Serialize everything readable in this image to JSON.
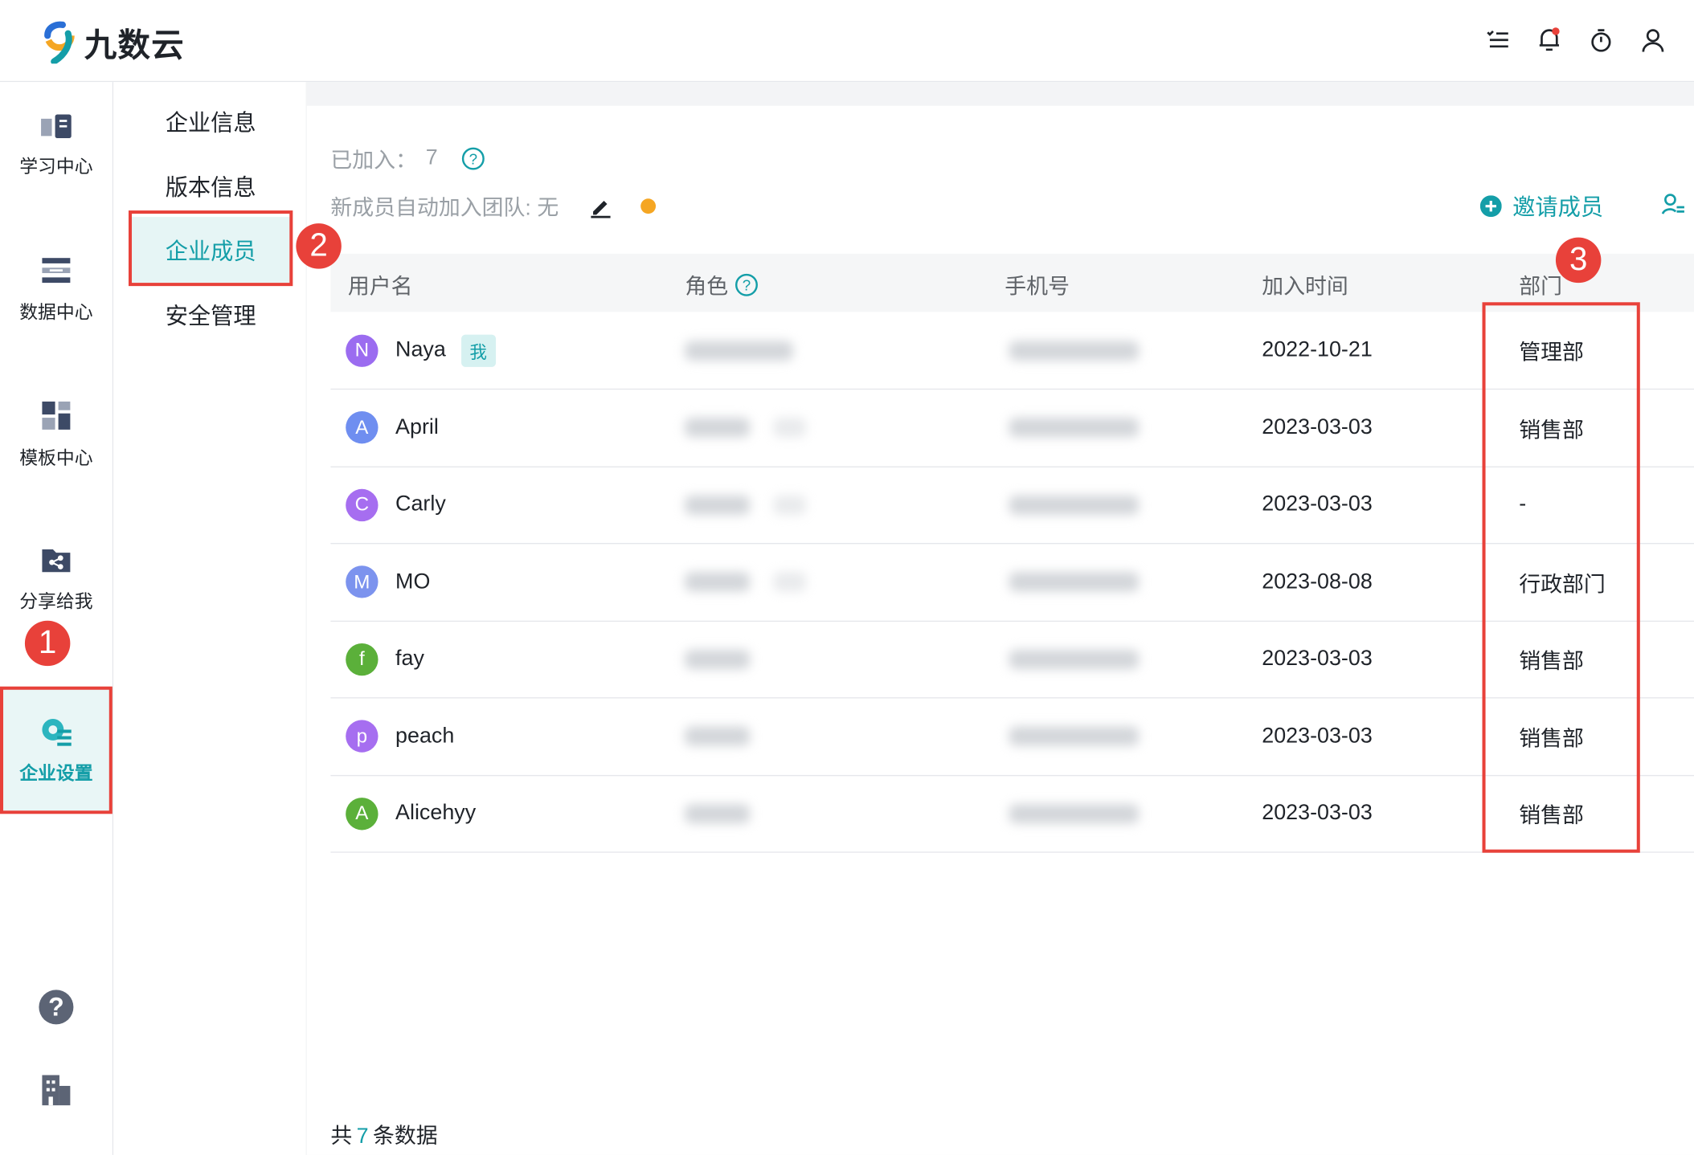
{
  "app": {
    "name": "九数云"
  },
  "leftnav": [
    {
      "label": "学习中心",
      "icon": "book-icon"
    },
    {
      "label": "数据中心",
      "icon": "database-icon"
    },
    {
      "label": "模板中心",
      "icon": "template-icon"
    },
    {
      "label": "分享给我",
      "icon": "share-folder-icon"
    },
    {
      "label": "企业设置",
      "icon": "enterprise-settings-icon"
    }
  ],
  "subnav": [
    "企业信息",
    "版本信息",
    "企业成员",
    "安全管理"
  ],
  "main": {
    "joined_label": "已加入：",
    "joined_count": "7",
    "autojoin_label": "新成员自动加入团队: 无",
    "invite_label": "邀请成员"
  },
  "table": {
    "headers": [
      "用户名",
      "角色",
      "手机号",
      "加入时间",
      "部门"
    ],
    "me_tag": "我",
    "rows": [
      {
        "initial": "N",
        "name": "Naya",
        "date": "2022-10-21",
        "dept": "管理部",
        "color": "#9b6cf0"
      },
      {
        "initial": "A",
        "name": "April",
        "date": "2023-03-03",
        "dept": "销售部",
        "color": "#6f8ef0"
      },
      {
        "initial": "C",
        "name": "Carly",
        "date": "2023-03-03",
        "dept": "-",
        "color": "#a66ef0"
      },
      {
        "initial": "M",
        "name": "MO",
        "date": "2023-08-08",
        "dept": "行政部门",
        "color": "#7c93ee"
      },
      {
        "initial": "f",
        "name": "fay",
        "date": "2023-03-03",
        "dept": "销售部",
        "color": "#5bb03a"
      },
      {
        "initial": "p",
        "name": "peach",
        "date": "2023-03-03",
        "dept": "销售部",
        "color": "#a66ef0"
      },
      {
        "initial": "A",
        "name": "Alicehyy",
        "date": "2023-03-03",
        "dept": "销售部",
        "color": "#5bb03a"
      }
    ]
  },
  "footer": {
    "prefix": "共",
    "count": "7",
    "suffix": "条数据"
  },
  "annotations": [
    "1",
    "2",
    "3"
  ],
  "colors": {
    "accent": "#149ea8",
    "annotation": "#e8413a",
    "orange_dot": "#f5a623"
  }
}
